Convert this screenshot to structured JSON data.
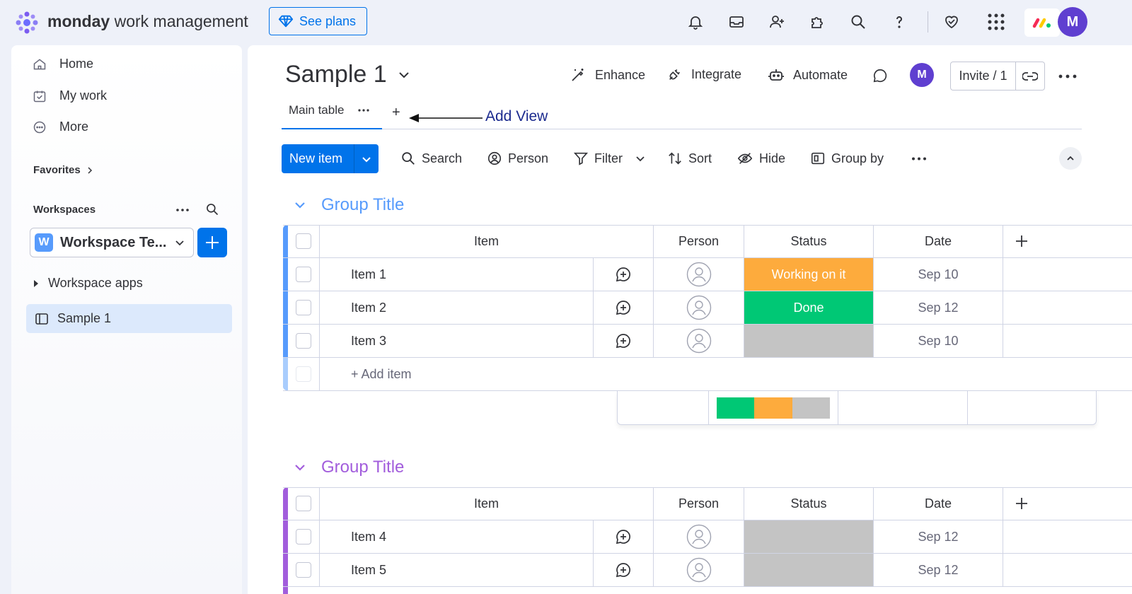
{
  "topbar": {
    "brand_bold": "monday",
    "brand_rest": "work management",
    "see_plans": "See plans",
    "avatar": "M"
  },
  "sidebar": {
    "nav": [
      {
        "label": "Home",
        "icon": "home-icon"
      },
      {
        "label": "My work",
        "icon": "calendar-check-icon"
      },
      {
        "label": "More",
        "icon": "more-circle-icon"
      }
    ],
    "favorites": "Favorites",
    "workspaces": "Workspaces",
    "workspace_badge": "W",
    "workspace_name": "Workspace Te...",
    "workspace_apps": "Workspace apps",
    "board_item": "Sample 1"
  },
  "board": {
    "title": "Sample 1",
    "actions": {
      "enhance": "Enhance",
      "integrate": "Integrate",
      "automate": "Automate"
    },
    "avatar": "M",
    "invite": "Invite / 1",
    "tab_main": "Main table",
    "tab_add": "+",
    "annotation": "Add View"
  },
  "toolbar": {
    "new_item": "New item",
    "search": "Search",
    "person": "Person",
    "filter": "Filter",
    "sort": "Sort",
    "hide": "Hide",
    "group_by": "Group by"
  },
  "columns": {
    "item": "Item",
    "person": "Person",
    "status": "Status",
    "date": "Date"
  },
  "groups": [
    {
      "title": "Group Title",
      "color": "#579bfc",
      "add_item": "+ Add item",
      "rows": [
        {
          "name": "Item 1",
          "status": "Working on it",
          "status_color": "#fdab3d",
          "date": "Sep 10"
        },
        {
          "name": "Item 2",
          "status": "Done",
          "status_color": "#00c875",
          "date": "Sep 12"
        },
        {
          "name": "Item 3",
          "status": "",
          "status_color": "#c4c4c4",
          "date": "Sep 10"
        }
      ],
      "summary": [
        {
          "color": "#00c875",
          "fraction": 0.3333
        },
        {
          "color": "#fdab3d",
          "fraction": 0.3333
        },
        {
          "color": "#c4c4c4",
          "fraction": 0.3334
        }
      ]
    },
    {
      "title": "Group Title",
      "color": "#a25ddc",
      "rows": [
        {
          "name": "Item 4",
          "status": "",
          "status_color": "#c4c4c4",
          "date": "Sep 12"
        },
        {
          "name": "Item 5",
          "status": "",
          "status_color": "#c4c4c4",
          "date": "Sep 12"
        }
      ]
    }
  ],
  "colors": {
    "primary": "#0073ea",
    "avatar": "#5f3fd0"
  }
}
